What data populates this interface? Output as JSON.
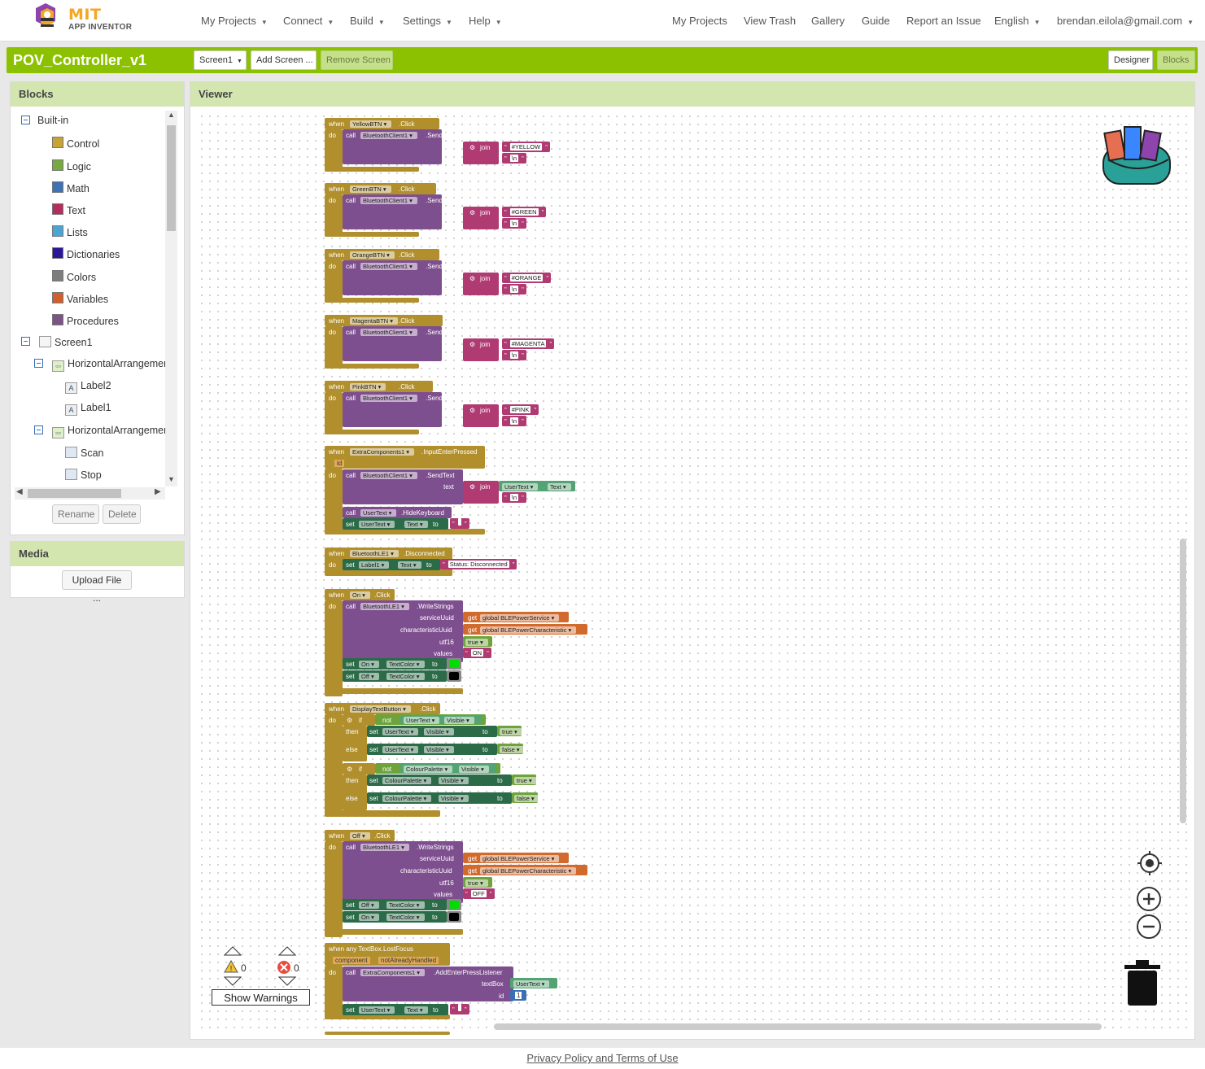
{
  "app": {
    "logo_title": "MIT",
    "logo_sub": "APP INVENTOR"
  },
  "nav_left": [
    "My Projects",
    "Connect",
    "Build",
    "Settings",
    "Help"
  ],
  "nav_right": [
    "My Projects",
    "View Trash",
    "Gallery",
    "Guide",
    "Report an Issue",
    "English",
    "brendan.eilola@gmail.com"
  ],
  "project": {
    "title": "POV_Controller_v1",
    "screen_select": "Screen1",
    "add_screen": "Add Screen ...",
    "remove_screen": "Remove Screen",
    "designer": "Designer",
    "blocks": "Blocks"
  },
  "blocks_panel": {
    "title": "Blocks",
    "builtin": "Built-in",
    "builtin_items": [
      {
        "label": "Control",
        "color": "#c8a334"
      },
      {
        "label": "Logic",
        "color": "#77ab41"
      },
      {
        "label": "Math",
        "color": "#3f71b5"
      },
      {
        "label": "Text",
        "color": "#b32d5e"
      },
      {
        "label": "Lists",
        "color": "#49a6d4"
      },
      {
        "label": "Dictionaries",
        "color": "#2d1799"
      },
      {
        "label": "Colors",
        "color": "#7d7d7d"
      },
      {
        "label": "Variables",
        "color": "#d05f2d"
      },
      {
        "label": "Procedures",
        "color": "#7c5385"
      }
    ],
    "screen": "Screen1",
    "components": [
      {
        "label": "HorizontalArrangemen",
        "level": 1
      },
      {
        "label": "Label2",
        "level": 2
      },
      {
        "label": "Label1",
        "level": 2
      },
      {
        "label": "HorizontalArrangemen",
        "level": 1
      },
      {
        "label": "Scan",
        "level": 2
      },
      {
        "label": "Stop",
        "level": 2
      }
    ],
    "rename": "Rename",
    "delete": "Delete"
  },
  "media_panel": {
    "title": "Media",
    "upload": "Upload File ..."
  },
  "viewer": {
    "title": "Viewer"
  },
  "warnings": {
    "warn_count": "0",
    "error_count": "0",
    "show_warnings": "Show Warnings"
  },
  "footer": {
    "link": "Privacy Policy and Terms of Use"
  },
  "blocks_code": {
    "when": "when",
    "do": "do",
    "call": "call",
    "text": "text",
    "join": "join",
    "set": "set",
    "to": "to",
    "get": "get",
    "color_events": [
      {
        "button": "YellowBTN",
        "event": ".Click",
        "component": "BluetoothClient1",
        "method": ".SendText",
        "string": "#YELLOW",
        "newline": "\\n"
      },
      {
        "button": "GreenBTN",
        "event": ".Click",
        "component": "BluetoothClient1",
        "method": ".SendText",
        "string": "#GREEN",
        "newline": "\\n"
      },
      {
        "button": "OrangeBTN",
        "event": ".Click",
        "component": "BluetoothClient1",
        "method": ".SendText",
        "string": "#ORANGE",
        "newline": "\\n"
      },
      {
        "button": "MagentaBTN",
        "event": ".Click",
        "component": "BluetoothClient1",
        "method": ".SendText",
        "string": "#MAGENTA",
        "newline": "\\n"
      },
      {
        "button": "PinkBTN",
        "event": ".Click",
        "component": "BluetoothClient1",
        "method": ".SendText",
        "string": "#PINK",
        "newline": "\\n"
      }
    ],
    "extra": {
      "component": "ExtraComponents1",
      "event": ".InputEnterPressed",
      "param": "id",
      "bt": "BluetoothClient1",
      "method": ".SendText",
      "usertext": "UserText",
      "prop_text": "Text",
      "newline": "\\n",
      "hide": ".HideKeyboard",
      "empty": " "
    },
    "disconnected": {
      "component": "BluetoothLE1",
      "event": ".Disconnected",
      "label": "Label1",
      "prop": "Text",
      "value": "Status: Disconnected"
    },
    "on_click": {
      "button": "On",
      "event": ".Click",
      "ble": "BluetoothLE1",
      "method": ".WriteStrings",
      "arg1": "serviceUuid",
      "arg2": "characteristicUuid",
      "arg3": "utf16",
      "arg4": "values",
      "var1": "global BLEPowerService",
      "var2": "global BLEPowerCharacteristic",
      "bool": "true",
      "value": "ON",
      "set1": "On",
      "set2": "Off",
      "prop": "TextColor"
    },
    "display": {
      "button": "DisplayTextButton",
      "event": ".Click",
      "if": "if",
      "then": "then",
      "else": "else",
      "not": "not",
      "usertext": "UserText",
      "palette": "ColourPalette",
      "visible": "Visible",
      "true": "true",
      "false": "false"
    },
    "off_click": {
      "button": "Off",
      "event": ".Click",
      "ble": "BluetoothLE1",
      "method": ".WriteStrings",
      "arg1": "serviceUuid",
      "arg2": "characteristicUuid",
      "arg3": "utf16",
      "arg4": "values",
      "var1": "global BLEPowerService",
      "var2": "global BLEPowerCharacteristic",
      "bool": "true",
      "value": "OFF",
      "set1": "Off",
      "set2": "On",
      "prop": "TextColor"
    },
    "lost_focus": {
      "event": "when any TextBox.LostFocus",
      "p1": "component",
      "p2": "notAlreadyHandled",
      "component": "ExtraComponents1",
      "method": ".AddEnterPressListener",
      "arg1": "textBox",
      "arg2": "id",
      "usertext": "UserText",
      "num": "1",
      "prop": "Text"
    }
  }
}
